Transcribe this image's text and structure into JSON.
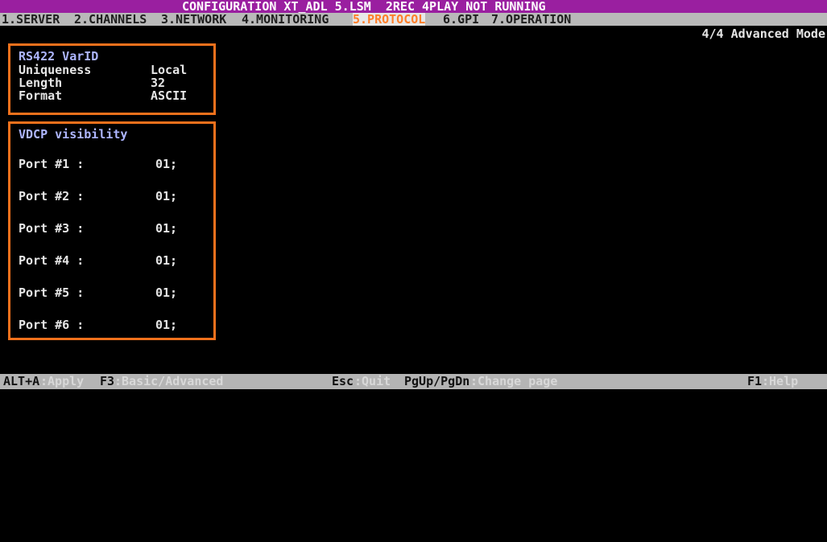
{
  "title": {
    "text": "CONFIGURATION XT_ADL 5.LSM  2REC 4PLAY NOT RUNNING"
  },
  "menu": {
    "items": [
      {
        "label": "1.SERVER"
      },
      {
        "label": "2.CHANNELS"
      },
      {
        "label": "3.NETWORK"
      },
      {
        "label": "4.MONITORING"
      },
      {
        "label": "5.PROTOCOL",
        "active": true
      },
      {
        "label": "6.GPI"
      },
      {
        "label": "7.OPERATION"
      }
    ]
  },
  "mode_label": "4/4 Advanced Mode",
  "varid_panel": {
    "heading": "RS422 VarID",
    "rows": [
      {
        "label": "Uniqueness",
        "value": "Local"
      },
      {
        "label": "Length",
        "value": "32"
      },
      {
        "label": "Format",
        "value": "ASCII"
      }
    ]
  },
  "udcp_panel": {
    "heading": "VDCP visibility",
    "ports": [
      {
        "label": "Port #1 :",
        "value": "01;"
      },
      {
        "label": "Port #2 :",
        "value": "01;"
      },
      {
        "label": "Port #3 :",
        "value": "01;"
      },
      {
        "label": "Port #4 :",
        "value": "01;"
      },
      {
        "label": "Port #5 :",
        "value": "01;"
      },
      {
        "label": "Port #6 :",
        "value": "01;"
      }
    ]
  },
  "statusbar": {
    "items": [
      {
        "key": "ALT+A",
        "desc": ":Apply"
      },
      {
        "key": "F3",
        "desc": ":Basic/Advanced"
      },
      {
        "key": "Esc",
        "desc": ":Quit"
      },
      {
        "key": "PgUp/PgDn",
        "desc": ":Change page"
      },
      {
        "key": "F1",
        "desc": ":Help"
      }
    ]
  },
  "colors": {
    "title_bg": "#9a1fa0",
    "menu_bg": "#b9b9b9",
    "active_tab": "#ff7f2a",
    "panel_border": "#f2711c",
    "heading": "#aeb6ff",
    "screen_bg": "#000000"
  }
}
